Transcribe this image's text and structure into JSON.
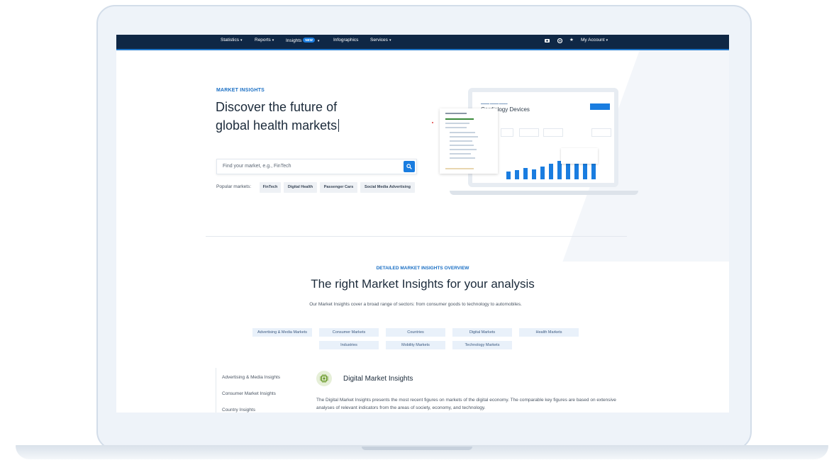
{
  "nav": {
    "statistics": "Statistics",
    "reports": "Reports",
    "insights": "Insights",
    "new_badge": "NEW",
    "infographics": "Infographics",
    "services": "Services",
    "account": "My Account"
  },
  "hero": {
    "eyebrow": "MARKET INSIGHTS",
    "title_line1": "Discover the future of",
    "title_line2": "global health markets"
  },
  "search": {
    "placeholder": "Find your market, e.g., FinTech"
  },
  "popular": {
    "label": "Popular markets:",
    "chips": [
      "FinTech",
      "Digital Health",
      "Passenger Cars",
      "Social Media Advertising"
    ]
  },
  "mockup": {
    "title": "Cardiology Devices"
  },
  "section": {
    "eyebrow": "DETAILED MARKET INSIGHTS OVERVIEW",
    "title": "The right Market Insights for your analysis",
    "description": "Our Market Insights cover a broad range of sectors: from consumer goods to technology to automobiles.",
    "categories_row1": [
      "Advertising & Media Markets",
      "Consumer Markets",
      "Countries",
      "Digital Markets",
      "Health Markets"
    ],
    "categories_row2": [
      "Industries",
      "Mobility Markets",
      "Technology Markets"
    ]
  },
  "sidebar": {
    "items": [
      "Advertising & Media Insights",
      "Consumer Market Insights",
      "Country Insights"
    ]
  },
  "digital": {
    "title": "Digital Market Insights",
    "description": "The Digital Market Insights presents the most recent figures on markets of the digital economy. The comparable key figures are based on extensive analyses of relevant indicators from the areas of society, economy, and technology."
  },
  "colors": {
    "nav_bg": "#0f2745",
    "accent": "#1a7de0",
    "chip_bg": "#eef1f5",
    "category_bg": "#e9f1fa"
  },
  "icons": [
    "camera-icon",
    "globe-icon",
    "star-icon",
    "search-icon",
    "chip-icon"
  ]
}
